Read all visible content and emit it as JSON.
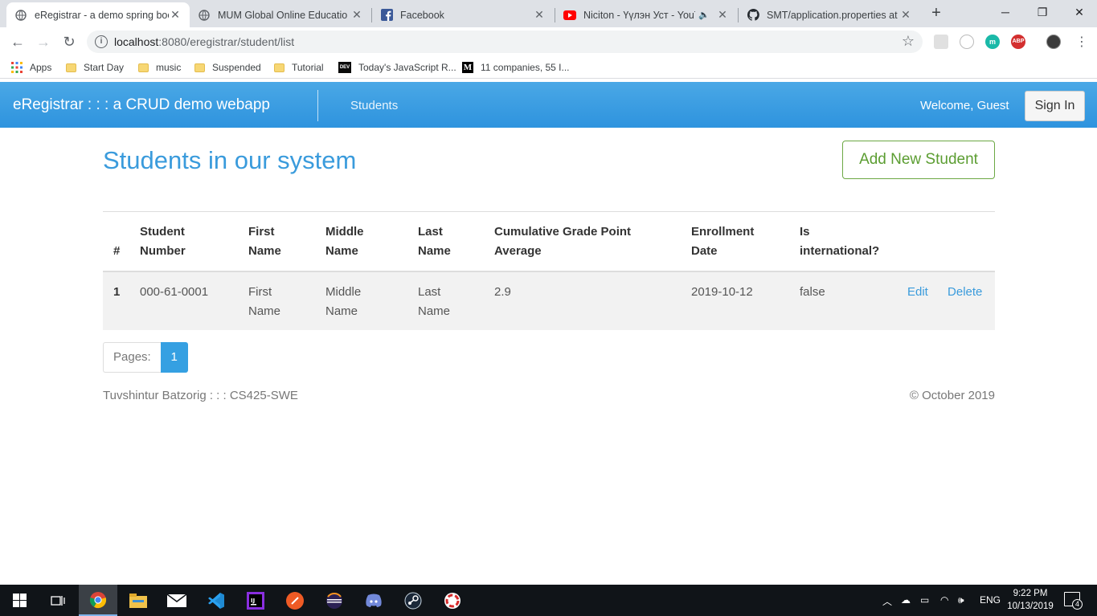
{
  "browser": {
    "tabs": [
      {
        "title": "eRegistrar - a demo spring boo",
        "icon": "globe-icon"
      },
      {
        "title": "MUM Global Online Educatio",
        "icon": "globe-icon"
      },
      {
        "title": "Facebook",
        "icon": "facebook-icon"
      },
      {
        "title": "Niciton - Үүлэн Уст - YouTu",
        "icon": "youtube-icon"
      },
      {
        "title": "SMT/application.properties at",
        "icon": "github-icon"
      }
    ],
    "url_host": "localhost",
    "url_path": ":8080/eregistrar/student/list",
    "bookmarks": [
      {
        "label": "Apps",
        "icon": "apps-grid-icon"
      },
      {
        "label": "Start Day",
        "icon": "folder-icon"
      },
      {
        "label": "music",
        "icon": "folder-icon"
      },
      {
        "label": "Suspended",
        "icon": "folder-icon"
      },
      {
        "label": "Tutorial",
        "icon": "folder-icon"
      },
      {
        "label": "Today's JavaScript R...",
        "icon": "dev-icon"
      },
      {
        "label": "11 companies, 55 I...",
        "icon": "medium-icon"
      }
    ]
  },
  "app": {
    "brand": "eRegistrar : : : a CRUD demo webapp",
    "nav_students": "Students",
    "welcome": "Welcome, Guest",
    "sign_in": "Sign In",
    "page_title": "Students in our system",
    "add_button": "Add New Student",
    "table": {
      "headers": [
        "#",
        "Student Number",
        "First Name",
        "Middle Name",
        "Last Name",
        "Cumulative Grade Point Average",
        "Enrollment Date",
        "Is international?"
      ],
      "rows": [
        {
          "num": "1",
          "student_number": "000-61-0001",
          "first_name": "First Name",
          "middle_name": "Middle Name",
          "last_name": "Last Name",
          "cgpa": "2.9",
          "enrollment_date": "2019-10-12",
          "is_international": "false",
          "edit": "Edit",
          "delete": "Delete"
        }
      ]
    },
    "pager_label": "Pages:",
    "current_page": "1",
    "footer_left": "Tuvshintur Batzorig : : : CS425-SWE",
    "footer_right": "© October 2019"
  },
  "taskbar": {
    "lang": "ENG",
    "time": "9:22 PM",
    "date": "10/13/2019",
    "notifications": "4"
  },
  "colors": {
    "accent": "#3a9bdc",
    "navbar": "#2e93de",
    "add_button": "#5b9d31"
  }
}
